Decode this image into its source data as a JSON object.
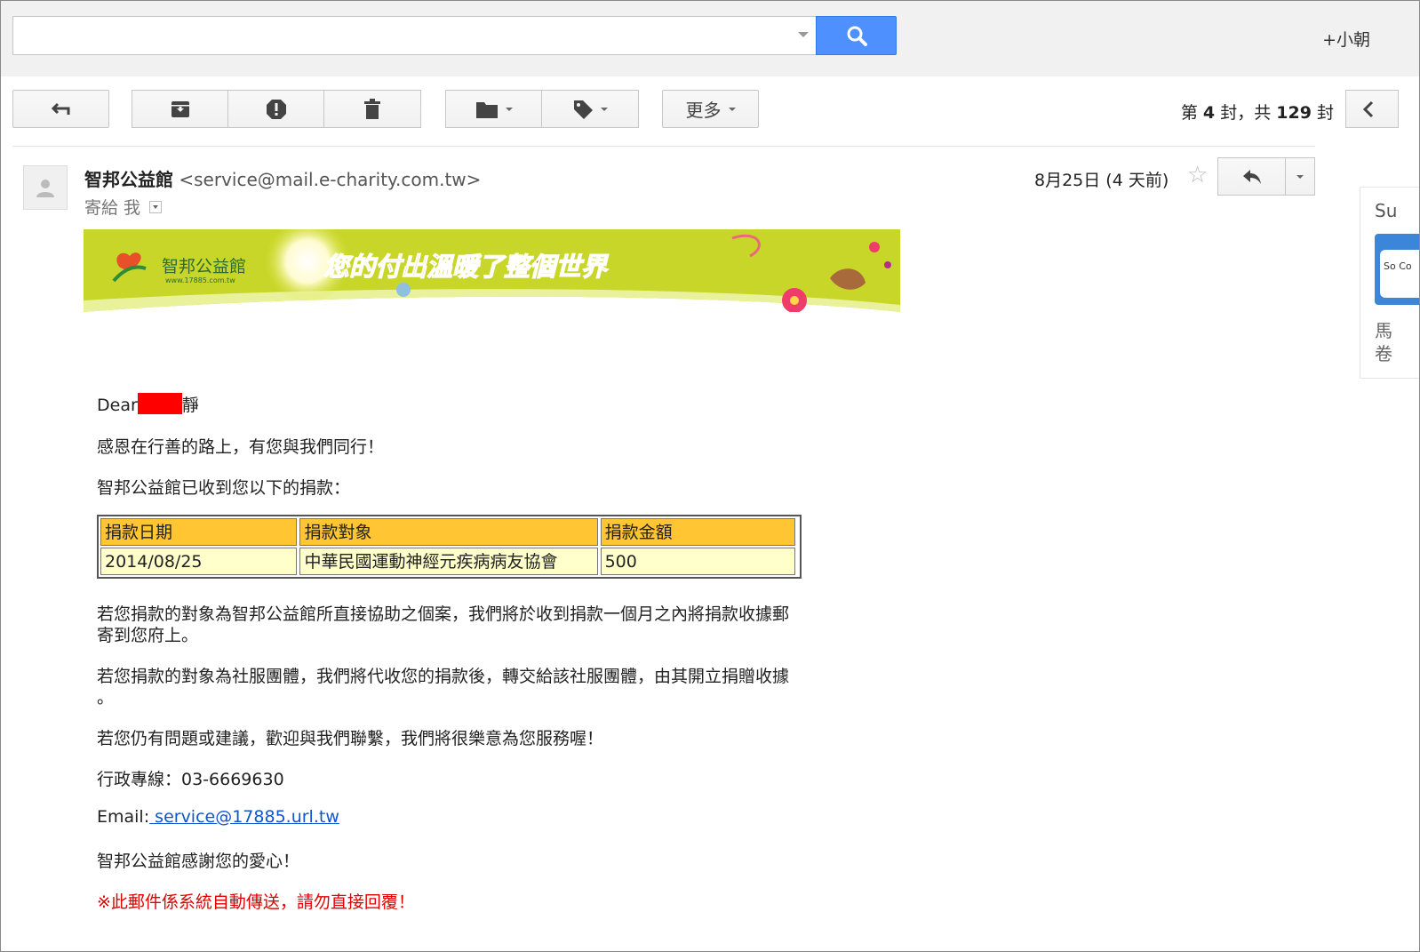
{
  "topbar": {
    "search_value": "",
    "user_name": "+小朝"
  },
  "toolbar": {
    "more_label": "更多",
    "pager_prefix": "第",
    "pager_current": "4",
    "pager_mid": "封，共",
    "pager_total": "129",
    "pager_suffix": "封"
  },
  "message": {
    "sender_name": "智邦公益館",
    "sender_email": "<service@mail.e-charity.com.tw>",
    "to_line": "寄給 我",
    "date": "8月25日 (4 天前)"
  },
  "side_panel": {
    "text1": "Su",
    "logo_text": "So Co",
    "text2a": "馬",
    "text2b": "卷"
  },
  "banner": {
    "logo_name": "智邦公益館",
    "logo_url": "www.17885.com.tw",
    "slogan": "您的付出溫暖了整個世界"
  },
  "body": {
    "greeting_prefix": "Dear",
    "greeting_suffix": "靜",
    "line1": "感恩在行善的路上，有您與我們同行！",
    "line2": "智邦公益館已收到您以下的捐款：",
    "table": {
      "headers": [
        "捐款日期",
        "捐款對象",
        "捐款金額"
      ],
      "row": [
        "2014/08/25",
        "中華民國運動神經元疾病病友協會",
        "500"
      ]
    },
    "para1_line1": "若您捐款的對象為智邦公益館所直接協助之個案，我們將於收到捐款一個月之內將捐款收據郵",
    "para1_line2": "寄到您府上。",
    "para2_line1": "若您捐款的對象為社服團體，我們將代收您的捐款後，轉交給該社服團體，由其開立捐贈收據",
    "para2_line2": "。",
    "para3": "若您仍有問題或建議，歡迎與我們聯繫，我們將很樂意為您服務喔！",
    "phone_line": "行政專線：03-6669630",
    "email_label": "Email:",
    "email_link": " service@17885.url.tw",
    "thanks": "智邦公益館感謝您的愛心！",
    "warning": "※此郵件係系統自動傳送，請勿直接回覆！"
  },
  "colors": {
    "search_button": "#4d90fe",
    "table_header": "#ffc533",
    "table_data": "#ffffcc",
    "banner_bg": "#c8d62a",
    "warning": "#e00000",
    "link": "#1155cc"
  }
}
